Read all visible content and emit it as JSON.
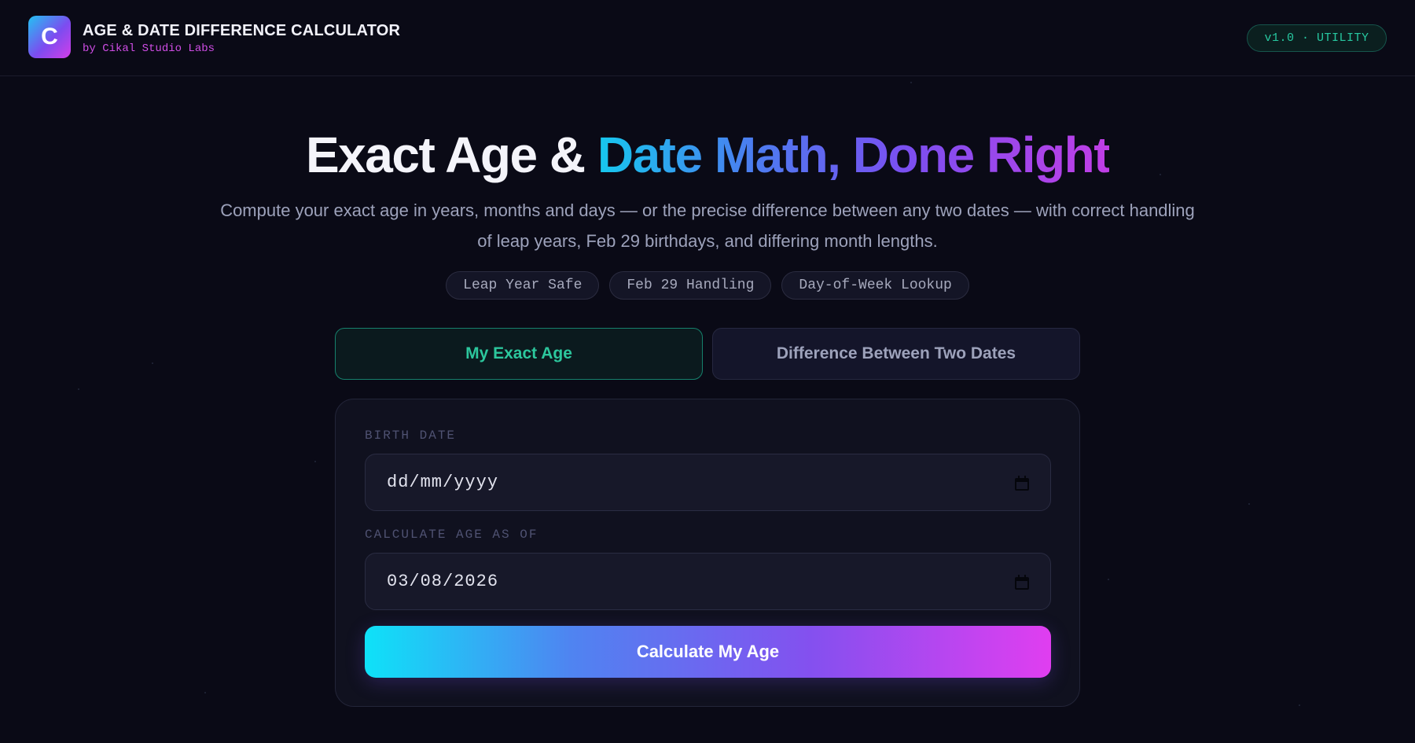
{
  "header": {
    "logo_letter": "C",
    "title": "AGE & DATE DIFFERENCE CALCULATOR",
    "subtitle": "by Cikal Studio Labs",
    "version_badge": "v1.0 · UTILITY"
  },
  "hero": {
    "title_plain": "Exact Age & ",
    "title_gradient": "Date Math, Done Right",
    "description": "Compute your exact age in years, months and days — or the precise difference between any two dates — with correct handling of leap years, Feb 29 birthdays, and differing month lengths.",
    "features": [
      "Leap Year Safe",
      "Feb 29 Handling",
      "Day-of-Week Lookup"
    ]
  },
  "tabs": [
    {
      "label": "My Exact Age",
      "active": true
    },
    {
      "label": "Difference Between Two Dates",
      "active": false
    }
  ],
  "form": {
    "birth_date_label": "BIRTH DATE",
    "birth_date_value": "dd/mm/yyyy",
    "as_of_label": "CALCULATE AGE AS OF",
    "as_of_value": "03/08/2026",
    "submit_label": "Calculate My Age",
    "calendar_icon": "calendar-icon"
  },
  "colors": {
    "background": "#0a0a16",
    "accent_teal": "#2cc79d",
    "accent_magenta": "#d04de6",
    "gradient_start": "#0ee2f8",
    "gradient_end": "#e03ef0"
  }
}
